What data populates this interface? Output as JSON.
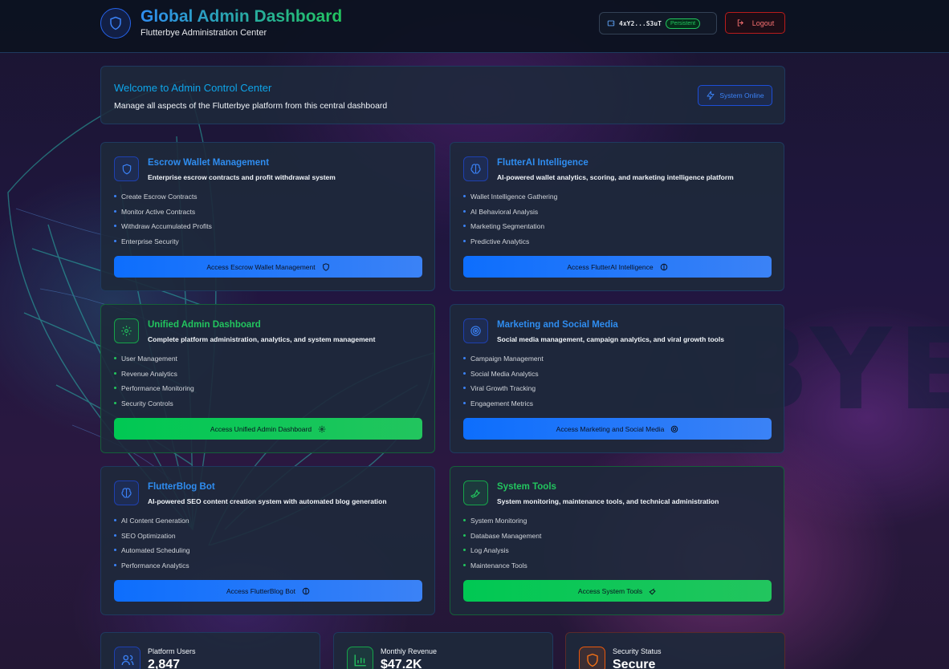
{
  "header": {
    "title": "Global Admin Dashboard",
    "subtitle": "Flutterbye Administration Center",
    "wallet_address": "4xY2...S3uT",
    "wallet_badge": "Persistent",
    "logout_label": "Logout"
  },
  "welcome": {
    "title": "Welcome to Admin Control Center",
    "subtitle": "Manage all aspects of the Flutterbye platform from this central dashboard",
    "status_label": "System Online"
  },
  "cards": [
    {
      "title": "Escrow Wallet Management",
      "description": "Enterprise escrow contracts and profit withdrawal system",
      "features": [
        "Create Escrow Contracts",
        "Monitor Active Contracts",
        "Withdraw Accumulated Profits",
        "Enterprise Security"
      ],
      "button": "Access Escrow Wallet Management",
      "icon": "shield-icon",
      "color": "#2f8df0"
    },
    {
      "title": "FlutterAI Intelligence",
      "description": "AI-powered wallet analytics, scoring, and marketing intelligence platform",
      "features": [
        "Wallet Intelligence Gathering",
        "AI Behavioral Analysis",
        "Marketing Segmentation",
        "Predictive Analytics"
      ],
      "button": "Access FlutterAI Intelligence",
      "icon": "brain-icon",
      "color": "#2f8df0"
    },
    {
      "title": "Unified Admin Dashboard",
      "description": "Complete platform administration, analytics, and system management",
      "features": [
        "User Management",
        "Revenue Analytics",
        "Performance Monitoring",
        "Security Controls"
      ],
      "button": "Access Unified Admin Dashboard",
      "icon": "gear-icon",
      "color": "#22c55e"
    },
    {
      "title": "Marketing and Social Media",
      "description": "Social media management, campaign analytics, and viral growth tools",
      "features": [
        "Campaign Management",
        "Social Media Analytics",
        "Viral Growth Tracking",
        "Engagement Metrics"
      ],
      "button": "Access Marketing and Social Media",
      "icon": "target-icon",
      "color": "#2f8df0"
    },
    {
      "title": "FlutterBlog Bot",
      "description": "AI-powered SEO content creation system with automated blog generation",
      "features": [
        "AI Content Generation",
        "SEO Optimization",
        "Automated Scheduling",
        "Performance Analytics"
      ],
      "button": "Access FlutterBlog Bot",
      "icon": "brain-icon",
      "color": "#2f8df0"
    },
    {
      "title": "System Tools",
      "description": "System monitoring, maintenance tools, and technical administration",
      "features": [
        "System Monitoring",
        "Database Management",
        "Log Analysis",
        "Maintenance Tools"
      ],
      "button": "Access System Tools",
      "icon": "wrench-icon",
      "color": "#22c55e"
    }
  ],
  "stats": [
    {
      "label": "Platform Users",
      "value": "2,847",
      "icon": "users-icon",
      "color": "#3b82f6"
    },
    {
      "label": "Monthly Revenue",
      "value": "$47.2K",
      "icon": "bar-chart-icon",
      "color": "#22c55e"
    },
    {
      "label": "Security Status",
      "value": "Secure",
      "icon": "shield-icon",
      "color": "#f97316"
    }
  ]
}
